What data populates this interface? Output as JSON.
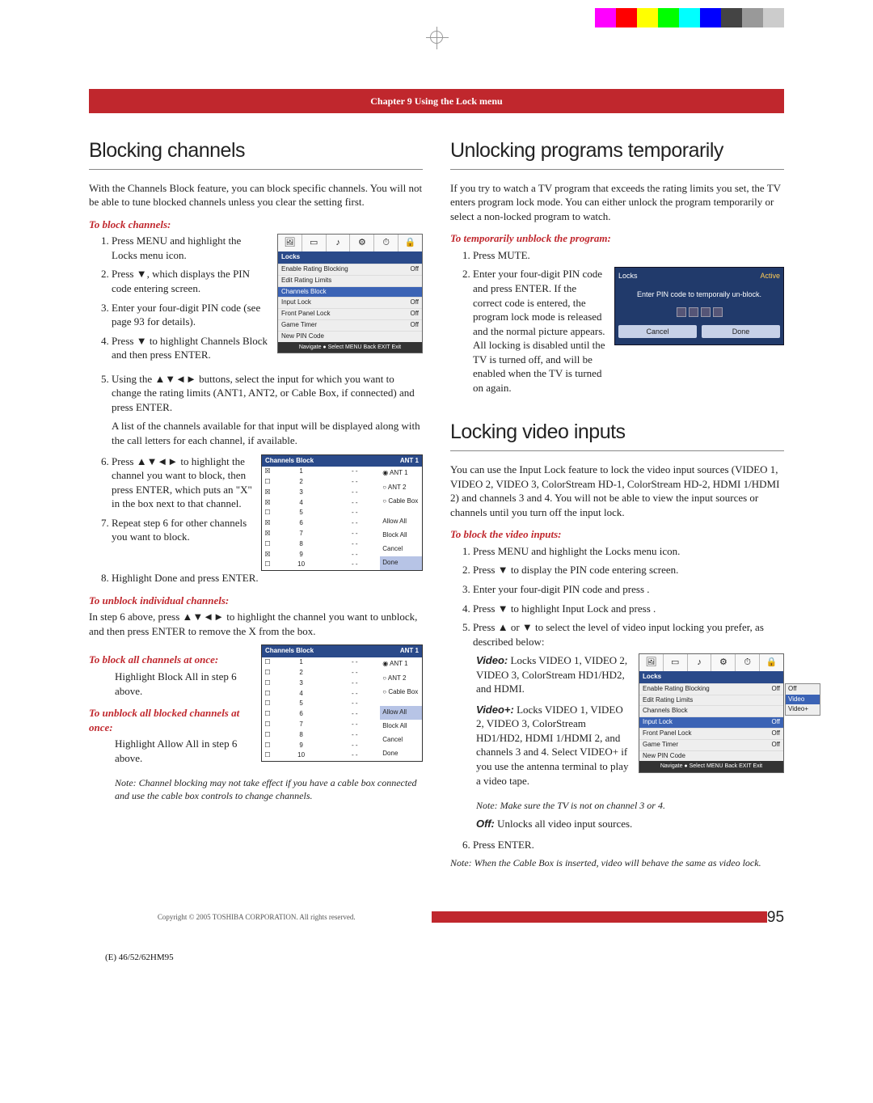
{
  "colorbar": [
    "#ff00ff",
    "#ff0000",
    "#ffff00",
    "#00ff00",
    "#00ffff",
    "#0000ff",
    "#444444",
    "#999999",
    "#cccccc"
  ],
  "banner": "Chapter 9  Using the Lock menu",
  "page_number": "95",
  "copyright": "Copyright © 2005 TOSHIBA CORPORATION. All rights reserved.",
  "model_line": "(E) 46/52/62HM95",
  "col1": {
    "h1": "Blocking channels",
    "intro": "With the Channels Block feature, you can block specific channels. You will not be able to tune blocked channels unless you clear the setting first.",
    "sub1": "To block channels:",
    "s1": "Press MENU and highlight the Locks menu icon.",
    "s2": "Press ▼, which displays the PIN code entering screen.",
    "s3": "Enter your four-digit PIN code (see page 93 for details).",
    "s4": "Press ▼ to highlight Channels Block and then press ENTER.",
    "s5a": "Using the ▲▼◄► buttons, select the input for which you want to change the rating limits (ANT1, ANT2, or Cable Box, if connected) and press ENTER.",
    "s5b": "A list of the channels available for that input will be displayed along with the call letters for each channel, if available.",
    "s6": "Press ▲▼◄► to highlight the channel you want to block, then press ENTER, which puts an \"X\" in the box next to that channel.",
    "s7": "Repeat step 6 for other channels you want to block.",
    "s8": "Highlight Done and press ENTER.",
    "sub2": "To unblock individual channels:",
    "unblock_p": "In step 6 above, press ▲▼◄► to highlight the channel you want to unblock, and then press ENTER to remove the X from the box.",
    "sub3": "To block all channels at once:",
    "blockall": "Highlight Block All in step 6 above.",
    "sub4": "To unblock all blocked channels at once:",
    "allowall": "Highlight Allow All in step 6 above.",
    "note1": "Note: Channel blocking may not take effect if you have a cable box connected and use the cable box controls to change channels.",
    "locks_menu": {
      "title": "Locks",
      "items": [
        {
          "l": "Enable Rating Blocking",
          "r": "Off"
        },
        {
          "l": "Edit Rating Limits",
          "r": ""
        },
        {
          "l": "Channels Block",
          "r": "",
          "sel": true
        },
        {
          "l": "Input Lock",
          "r": "Off"
        },
        {
          "l": "Front Panel Lock",
          "r": "Off"
        },
        {
          "l": "Game Timer",
          "r": "Off"
        },
        {
          "l": "New PIN Code",
          "r": ""
        }
      ],
      "footer": "Navigate   ● Select   MENU Back   EXIT Exit"
    },
    "chanblock1": {
      "title": "Channels Block",
      "right": "ANT 1",
      "rows": [
        {
          "x": true,
          "n": "1",
          "c": "- -"
        },
        {
          "x": false,
          "n": "2",
          "c": "- -"
        },
        {
          "x": true,
          "n": "3",
          "c": "- -"
        },
        {
          "x": true,
          "n": "4",
          "c": "- -"
        },
        {
          "x": false,
          "n": "5",
          "c": "- -"
        },
        {
          "x": true,
          "n": "6",
          "c": "- -"
        },
        {
          "x": true,
          "n": "7",
          "c": "- -"
        },
        {
          "x": false,
          "n": "8",
          "c": "- -"
        },
        {
          "x": true,
          "n": "9",
          "c": "- -"
        },
        {
          "x": false,
          "n": "10",
          "c": "- -"
        }
      ],
      "side": [
        "◉ ANT 1",
        "○ ANT 2",
        "○ Cable Box",
        "",
        "",
        "",
        "Allow All",
        "Block All",
        "Cancel",
        "Done"
      ],
      "side_sel_index": 9
    },
    "chanblock2": {
      "title": "Channels Block",
      "right": "ANT 1",
      "rows": [
        {
          "x": false,
          "n": "1",
          "c": "- -"
        },
        {
          "x": false,
          "n": "2",
          "c": "- -"
        },
        {
          "x": false,
          "n": "3",
          "c": "- -"
        },
        {
          "x": false,
          "n": "4",
          "c": "- -"
        },
        {
          "x": false,
          "n": "5",
          "c": "- -"
        },
        {
          "x": false,
          "n": "6",
          "c": "- -"
        },
        {
          "x": false,
          "n": "7",
          "c": "- -"
        },
        {
          "x": false,
          "n": "8",
          "c": "- -"
        },
        {
          "x": false,
          "n": "9",
          "c": "- -"
        },
        {
          "x": false,
          "n": "10",
          "c": "- -"
        }
      ],
      "side": [
        "◉ ANT 1",
        "○ ANT 2",
        "○ Cable Box",
        "",
        "",
        "",
        "Allow All",
        "Block All",
        "Cancel",
        "Done"
      ],
      "side_sel_index": 6
    }
  },
  "col2": {
    "h1a": "Unlocking programs temporarily",
    "p1": "If you try to watch a TV program that exceeds the rating limits you set, the TV enters program lock mode. You can either unlock the program temporarily or select a non-locked program to watch.",
    "sub1": "To temporarily unblock the program:",
    "s1": "Press MUTE.",
    "s2a": "Enter your four-digit PIN code and press ENTER. If the correct code is entered, the program lock mode is released and the normal picture appears. All locking is disabled until the TV is turned off, and will be enabled when the TV is turned on again.",
    "pin": {
      "title": "Locks",
      "badge": "Active",
      "msg": "Enter PIN code to temporaily un-block.",
      "btn1": "Cancel",
      "btn2": "Done"
    },
    "h1b": "Locking video inputs",
    "p2": "You can use the Input Lock feature to lock the video input sources (VIDEO 1, VIDEO 2, VIDEO 3, ColorStream HD-1, ColorStream HD-2, HDMI 1/HDMI 2) and channels 3 and 4. You will not be able to view the input sources or channels until you turn off the input lock.",
    "sub2": "To block the video inputs:",
    "b1": "Press MENU and highlight the Locks menu icon.",
    "b2": "Press ▼ to display the PIN code entering screen.",
    "b3": "Enter your four-digit PIN code and press  .",
    "b4": "Press ▼ to highlight Input Lock and press  .",
    "b5": "Press ▲ or ▼ to select the level of video input locking you prefer, as described below:",
    "video_label1_b": "Video:",
    "video_label1": " Locks VIDEO 1, VIDEO 2, VIDEO 3, ColorStream HD1/HD2, and HDMI.",
    "video_label2_b": "Video+:",
    "video_label2": " Locks VIDEO 1, VIDEO 2, VIDEO 3, ColorStream HD1/HD2, HDMI 1/HDMI 2, and channels 3 and 4. Select VIDEO+ if you use the antenna terminal to play a video tape.",
    "note2": "Note: Make sure the TV is not on channel 3 or 4.",
    "off_b": "Off:",
    "off": " Unlocks all video input sources.",
    "b6": "Press ENTER.",
    "note3": "Note: When the Cable Box is inserted, video will behave the same as video lock.",
    "locks_input": {
      "title": "Locks",
      "items": [
        {
          "l": "Enable Rating Blocking",
          "r": "Off"
        },
        {
          "l": "Edit Rating Limits",
          "r": ""
        },
        {
          "l": "Channels Block",
          "r": ""
        },
        {
          "l": "Input Lock",
          "r": "Off",
          "sel": true
        },
        {
          "l": "Front Panel Lock",
          "r": "Off"
        },
        {
          "l": "Game Timer",
          "r": "Off"
        },
        {
          "l": "New PIN Code",
          "r": ""
        }
      ],
      "opts": [
        "Off",
        "Video",
        "Video+"
      ],
      "opt_sel": 1,
      "footer": "Navigate   ● Select   MENU Back   EXIT Exit"
    }
  }
}
